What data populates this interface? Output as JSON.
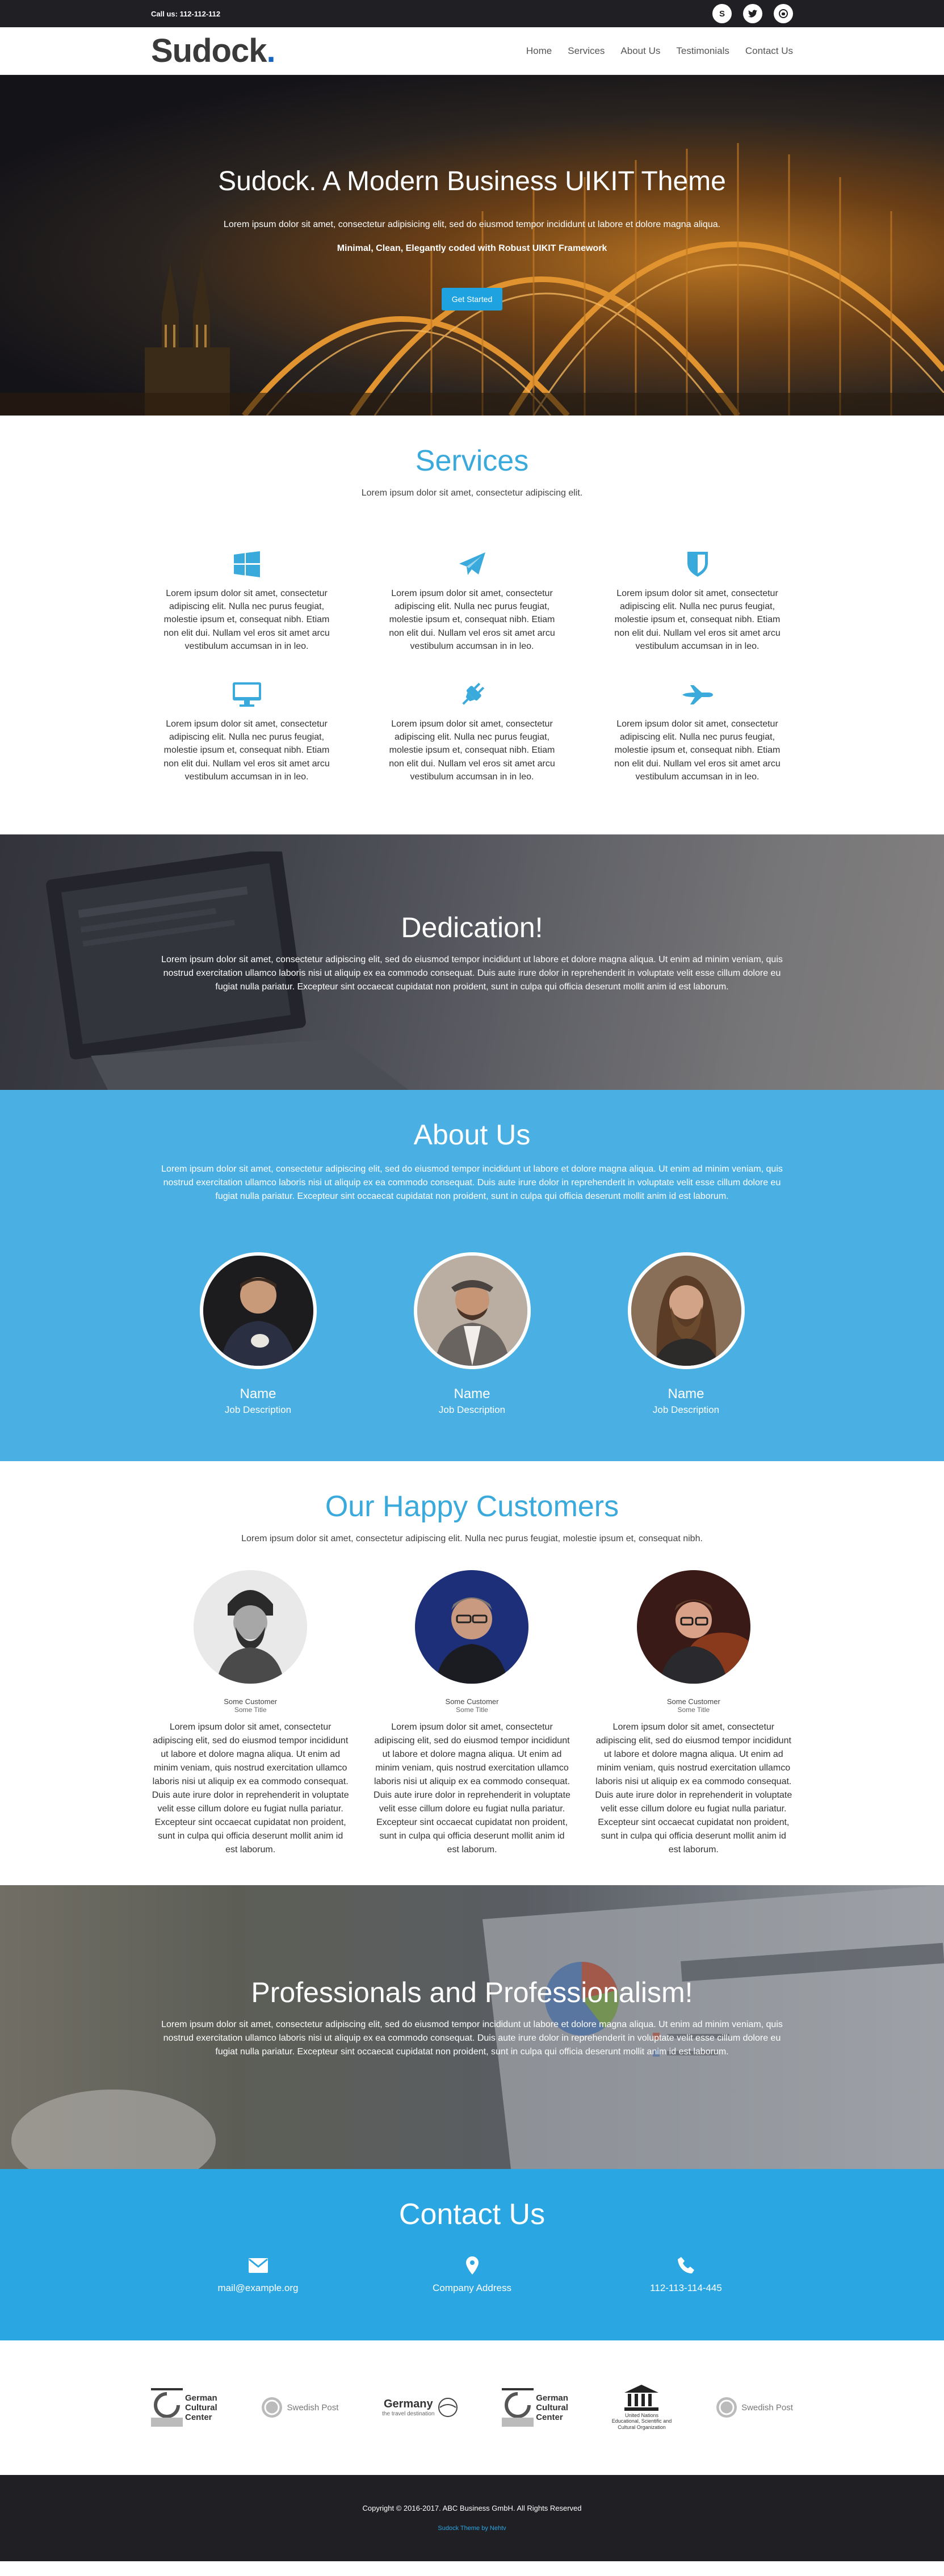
{
  "topbar": {
    "call": "Call us: 112-112-112",
    "socials": [
      "skype-icon",
      "twitter-icon",
      "github-icon"
    ]
  },
  "brand": {
    "name": "Sudock",
    "dot": "."
  },
  "nav": [
    "Home",
    "Services",
    "About Us",
    "Testimonials",
    "Contact Us"
  ],
  "hero": {
    "title": "Sudock. A Modern Business UIKIT Theme",
    "lead": "Lorem ipsum dolor sit amet, consectetur adipisicing elit, sed do eiusmod tempor incididunt ut labore et dolore magna aliqua.",
    "tagline": "Minimal, Clean, Elegantly coded with Robust UIKIT Framework",
    "cta": "Get Started"
  },
  "services": {
    "title": "Services",
    "subtitle": "Lorem ipsum dolor sit amet, consectetur adipiscing elit.",
    "items": [
      {
        "icon": "windows-icon",
        "text": "Lorem ipsum dolor sit amet, consectetur adipiscing elit. Nulla nec purus feugiat, molestie ipsum et, consequat nibh. Etiam non elit dui. Nullam vel eros sit amet arcu vestibulum accumsan in in leo."
      },
      {
        "icon": "paper-plane-icon",
        "text": "Lorem ipsum dolor sit amet, consectetur adipiscing elit. Nulla nec purus feugiat, molestie ipsum et, consequat nibh. Etiam non elit dui. Nullam vel eros sit amet arcu vestibulum accumsan in in leo."
      },
      {
        "icon": "shield-icon",
        "text": "Lorem ipsum dolor sit amet, consectetur adipiscing elit. Nulla nec purus feugiat, molestie ipsum et, consequat nibh. Etiam non elit dui. Nullam vel eros sit amet arcu vestibulum accumsan in in leo."
      },
      {
        "icon": "desktop-icon",
        "text": "Lorem ipsum dolor sit amet, consectetur adipiscing elit. Nulla nec purus feugiat, molestie ipsum et, consequat nibh. Etiam non elit dui. Nullam vel eros sit amet arcu vestibulum accumsan in in leo."
      },
      {
        "icon": "plug-icon",
        "text": "Lorem ipsum dolor sit amet, consectetur adipiscing elit. Nulla nec purus feugiat, molestie ipsum et, consequat nibh. Etiam non elit dui. Nullam vel eros sit amet arcu vestibulum accumsan in in leo."
      },
      {
        "icon": "plane-icon",
        "text": "Lorem ipsum dolor sit amet, consectetur adipiscing elit. Nulla nec purus feugiat, molestie ipsum et, consequat nibh. Etiam non elit dui. Nullam vel eros sit amet arcu vestibulum accumsan in in leo."
      }
    ]
  },
  "dedication": {
    "title": "Dedication!",
    "text": "Lorem ipsum dolor sit amet, consectetur adipiscing elit, sed do eiusmod tempor incididunt ut labore et dolore magna aliqua. Ut enim ad minim veniam, quis nostrud exercitation ullamco laboris nisi ut aliquip ex ea commodo consequat. Duis aute irure dolor in reprehenderit in voluptate velit esse cillum dolore eu fugiat nulla pariatur. Excepteur sint occaecat cupidatat non proident, sunt in culpa qui officia deserunt mollit anim id est laborum."
  },
  "about": {
    "title": "About Us",
    "text": "Lorem ipsum dolor sit amet, consectetur adipiscing elit, sed do eiusmod tempor incididunt ut labore et dolore magna aliqua. Ut enim ad minim veniam, quis nostrud exercitation ullamco laboris nisi ut aliquip ex ea commodo consequat. Duis aute irure dolor in reprehenderit in voluptate velit esse cillum dolore eu fugiat nulla pariatur. Excepteur sint occaecat cupidatat non proident, sunt in culpa qui officia deserunt mollit anim id est laborum.",
    "team": [
      {
        "name": "Name",
        "job": "Job Description"
      },
      {
        "name": "Name",
        "job": "Job Description"
      },
      {
        "name": "Name",
        "job": "Job Description"
      }
    ]
  },
  "customers": {
    "title": "Our Happy Customers",
    "subtitle": "Lorem ipsum dolor sit amet, consectetur adipiscing elit. Nulla nec purus feugiat, molestie ipsum et, consequat nibh.",
    "items": [
      {
        "name": "Some Customer",
        "title": "Some Title",
        "text": "Lorem ipsum dolor sit amet, consectetur adipiscing elit, sed do eiusmod tempor incididunt ut labore et dolore magna aliqua. Ut enim ad minim veniam, quis nostrud exercitation ullamco laboris nisi ut aliquip ex ea commodo consequat. Duis aute irure dolor in reprehenderit in voluptate velit esse cillum dolore eu fugiat nulla pariatur. Excepteur sint occaecat cupidatat non proident, sunt in culpa qui officia deserunt mollit anim id est laborum."
      },
      {
        "name": "Some Customer",
        "title": "Some Title",
        "text": "Lorem ipsum dolor sit amet, consectetur adipiscing elit, sed do eiusmod tempor incididunt ut labore et dolore magna aliqua. Ut enim ad minim veniam, quis nostrud exercitation ullamco laboris nisi ut aliquip ex ea commodo consequat. Duis aute irure dolor in reprehenderit in voluptate velit esse cillum dolore eu fugiat nulla pariatur. Excepteur sint occaecat cupidatat non proident, sunt in culpa qui officia deserunt mollit anim id est laborum."
      },
      {
        "name": "Some Customer",
        "title": "Some Title",
        "text": "Lorem ipsum dolor sit amet, consectetur adipiscing elit, sed do eiusmod tempor incididunt ut labore et dolore magna aliqua. Ut enim ad minim veniam, quis nostrud exercitation ullamco laboris nisi ut aliquip ex ea commodo consequat. Duis aute irure dolor in reprehenderit in voluptate velit esse cillum dolore eu fugiat nulla pariatur. Excepteur sint occaecat cupidatat non proident, sunt in culpa qui officia deserunt mollit anim id est laborum."
      }
    ]
  },
  "pros": {
    "title": "Professionals and Professionalism!",
    "text": "Lorem ipsum dolor sit amet, consectetur adipiscing elit, sed do eiusmod tempor incididunt ut labore et dolore magna aliqua. Ut enim ad minim veniam, quis nostrud exercitation ullamco laboris nisi ut aliquip ex ea commodo consequat. Duis aute irure dolor in reprehenderit in voluptate velit esse cillum dolore eu fugiat nulla pariatur. Excepteur sint occaecat cupidatat non proident, sunt in culpa qui officia deserunt mollit anim id est laborum."
  },
  "contact": {
    "title": "Contact Us",
    "items": [
      {
        "icon": "envelope-icon",
        "value": "mail@example.org"
      },
      {
        "icon": "map-marker-icon",
        "value": "Company Address"
      },
      {
        "icon": "phone-icon",
        "value": "112-113-114-445"
      }
    ]
  },
  "partners": {
    "gcc": [
      "German",
      "Cultural",
      "Center"
    ],
    "swedish_post": "Swedish Post",
    "germany": {
      "title": "Germany",
      "sub": "the travel destination"
    },
    "un": [
      "United Nations",
      "Educational, Scientific and",
      "Cultural Organization"
    ]
  },
  "footer": {
    "copyright": "Copyright © 2016-2017. ABC Business GmbH. All Rights Reserved",
    "credit": "Sudock Theme by Nehtv"
  },
  "colors": {
    "accent": "#3aa9dc",
    "about_bg": "#4ab0e3",
    "contact_bg": "#2aa6e3",
    "dark": "#1f1f24"
  }
}
